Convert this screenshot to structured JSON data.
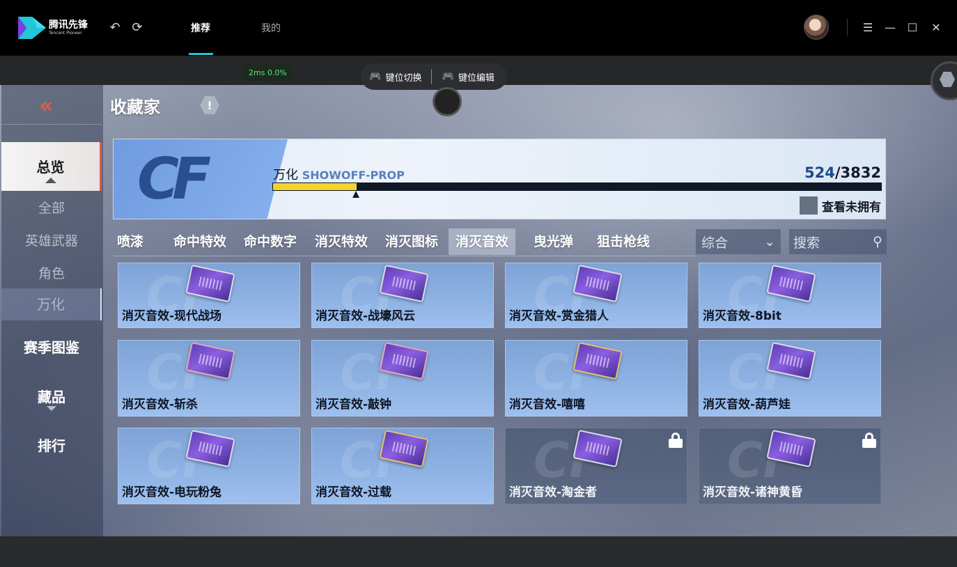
{
  "app": {
    "logo_cn": "腾讯先锋",
    "logo_en": "Tencent Pioneer",
    "nav": [
      {
        "label": "推荐",
        "active": true
      },
      {
        "label": "我的",
        "active": false
      }
    ]
  },
  "emulator": {
    "ping": "2ms  0.0%",
    "key_switch": "键位切换",
    "key_edit": "键位编辑"
  },
  "page": {
    "title": "收藏家",
    "info_badge": "!"
  },
  "sidebar": {
    "overview": "总览",
    "subitems": [
      "全部",
      "英雄武器",
      "角色",
      "万化"
    ],
    "season": "赛季图鉴",
    "collection": "藏品",
    "ranking": "排行"
  },
  "banner": {
    "title_cn": "万化",
    "title_en": "SHOWOFF-PROP",
    "owned": "524",
    "total": "/3832",
    "progress_fraction": 0.137,
    "view_unowned": "查看未拥有"
  },
  "tabs": [
    "喷漆",
    "命中特效",
    "命中数字",
    "消灭特效",
    "消灭图标",
    "消灭音效",
    "曳光弹",
    "狙击枪线"
  ],
  "active_tab": "消灭音效",
  "filters": {
    "sort": "综合",
    "search_placeholder": "搜索"
  },
  "items": [
    {
      "label": "消灭音效-现代战场",
      "locked": false
    },
    {
      "label": "消灭音效-战壕风云",
      "locked": false
    },
    {
      "label": "消灭音效-赏金猎人",
      "locked": false
    },
    {
      "label": "消灭音效-8bit",
      "locked": false
    },
    {
      "label": "消灭音效-斩杀",
      "locked": false
    },
    {
      "label": "消灭音效-敲钟",
      "locked": false
    },
    {
      "label": "消灭音效-嘻嘻",
      "locked": false
    },
    {
      "label": "消灭音效-葫芦娃",
      "locked": false
    },
    {
      "label": "消灭音效-电玩粉兔",
      "locked": false
    },
    {
      "label": "消灭音效-过载",
      "locked": false
    },
    {
      "label": "消灭音效-淘金者",
      "locked": true
    },
    {
      "label": "消灭音效-诸神黄昏",
      "locked": true
    }
  ],
  "colors": {
    "accent": "#21c7d8",
    "back_arrow": "#e25b4b",
    "progress_fill": "#f5d32a"
  }
}
